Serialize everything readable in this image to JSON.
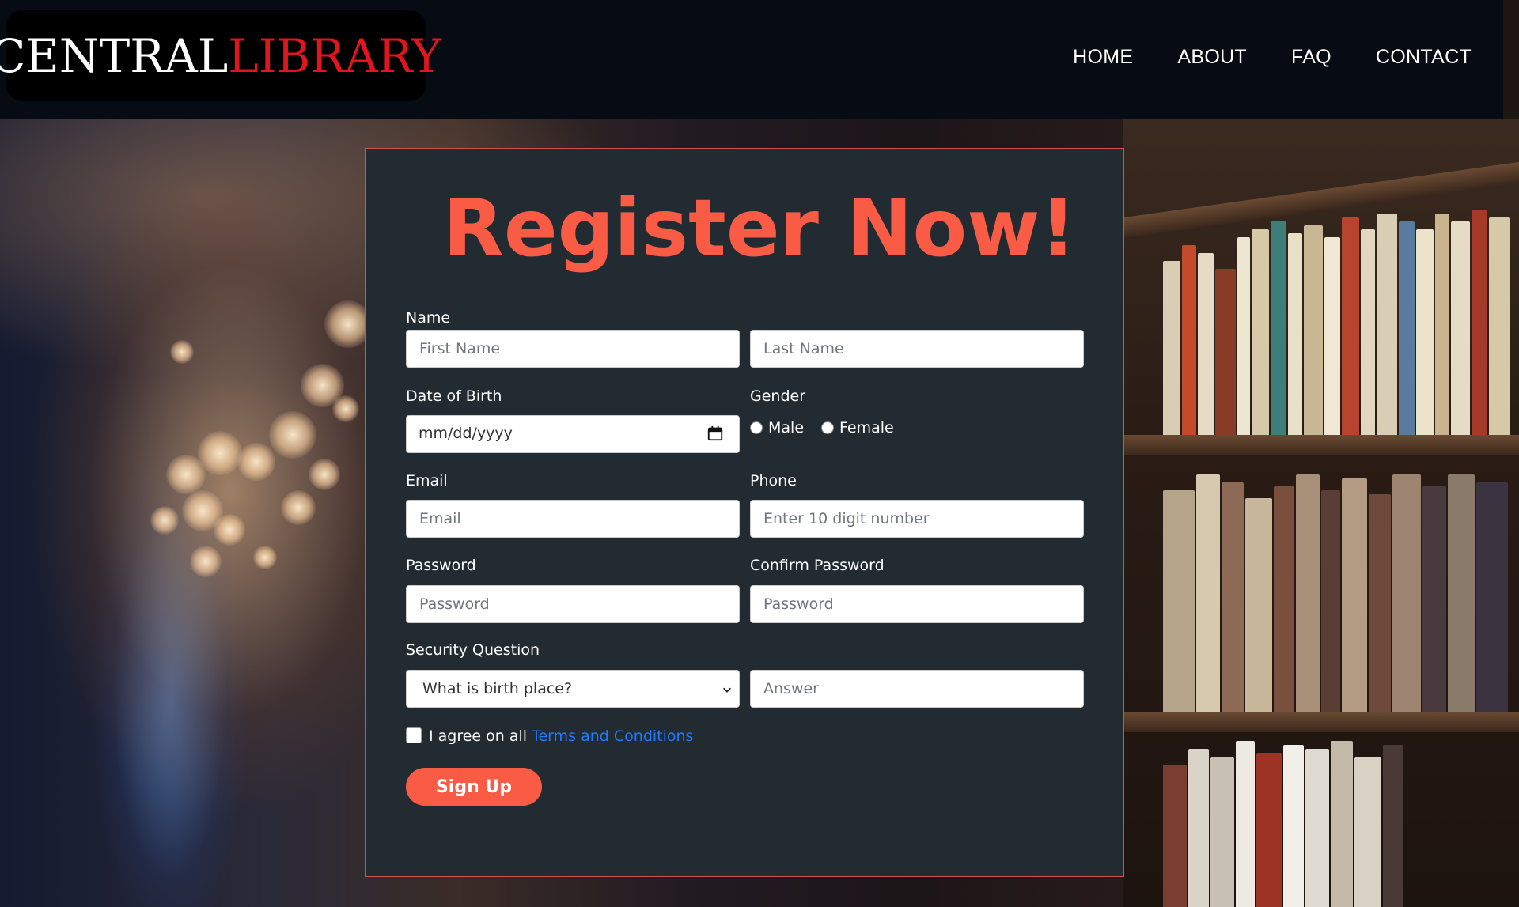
{
  "header": {
    "logo_main": "CENTRAL",
    "logo_accent": "LIBRARY",
    "nav": [
      "HOME",
      "ABOUT",
      "FAQ",
      "CONTACT"
    ]
  },
  "form": {
    "title": "Register Now!",
    "name_label": "Name",
    "first_name_placeholder": "First Name",
    "last_name_placeholder": "Last Name",
    "dob_label": "Date of Birth",
    "dob_value": "mm/dd/yyyy",
    "gender_label": "Gender",
    "gender_options": [
      "Male",
      "Female"
    ],
    "email_label": "Email",
    "email_placeholder": "Email",
    "phone_label": "Phone",
    "phone_placeholder": "Enter 10 digit number",
    "password_label": "Password",
    "password_placeholder": "Password",
    "confirm_label": "Confirm Password",
    "confirm_placeholder": "Password",
    "security_label": "Security Question",
    "security_selected": "What is birth place?",
    "answer_placeholder": "Answer",
    "agree_text": "I agree on all ",
    "terms_link": "Terms and Conditions",
    "submit_label": "Sign Up"
  },
  "colors": {
    "accent": "#fa5b45",
    "card_bg": "#222b32",
    "link": "#1f7bff",
    "logo_red": "#e0161e"
  },
  "icons": [
    "calendar-icon",
    "chevron-down-icon"
  ]
}
